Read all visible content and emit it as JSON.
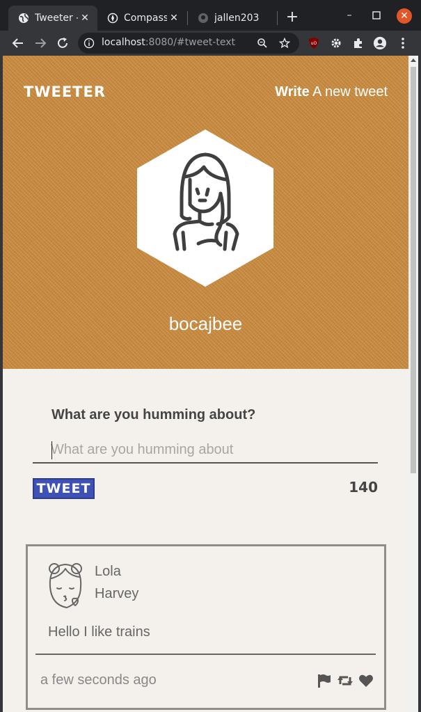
{
  "browser": {
    "tabs": [
      {
        "title": "Tweeter - ",
        "icon": "globe-icon",
        "active": true
      },
      {
        "title": "Compass",
        "icon": "compass-icon",
        "active": false
      },
      {
        "title": "jallen203",
        "icon": "github-icon",
        "active": false
      }
    ],
    "url": {
      "host": "localhost",
      "rest": ":8080/#tweet-text"
    }
  },
  "header": {
    "logo": "TWEETER",
    "write_strong": "Write",
    "write_light": " A new tweet"
  },
  "profile": {
    "username": "bocajbee"
  },
  "compose": {
    "label": "What are you humming about?",
    "placeholder": "What are you humming about",
    "button": "TWEET",
    "counter": "140"
  },
  "tweet": {
    "first_name": "Lola",
    "last_name": "Harvey",
    "text": "Hello I like trains",
    "time": "a few seconds ago"
  },
  "colors": {
    "hero": "#c98a3d",
    "page_bg": "#f4f1ec",
    "button": "#3f51b5"
  }
}
